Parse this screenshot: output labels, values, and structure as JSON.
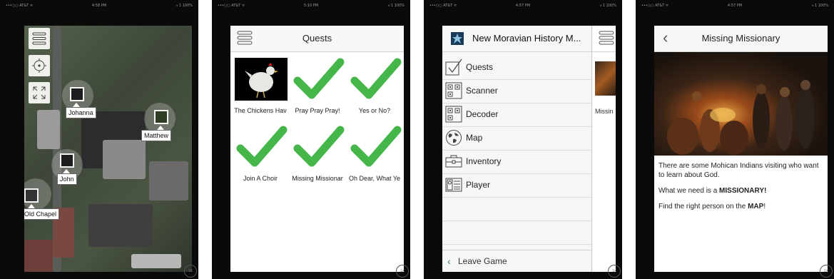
{
  "status_bar": {
    "carrier": "•••○○ AT&T ᯤ",
    "battery": "⁎ 1 100%"
  },
  "screens": [
    {
      "clock": "4:58 PM",
      "map": {
        "pins": [
          {
            "label": "Johanna"
          },
          {
            "label": "Matthew"
          },
          {
            "label": "John"
          },
          {
            "label": "Old Chapel"
          }
        ]
      },
      "zoom_badge": "1X"
    },
    {
      "clock": "5:10 PM",
      "title": "Quests",
      "quests": [
        {
          "label": "The Chickens Hav",
          "image": "chicken-image"
        },
        {
          "label": "Pray Pray Pray!",
          "image": "checkmark-icon"
        },
        {
          "label": "Yes or No?",
          "image": "checkmark-icon"
        },
        {
          "label": "Join A Choir",
          "image": "checkmark-icon"
        },
        {
          "label": "Missing Missionar",
          "image": "checkmark-icon"
        },
        {
          "label": "Oh Dear, What Ye",
          "image": "checkmark-icon"
        }
      ],
      "zoom_badge": "1X"
    },
    {
      "clock": "4:57 PM",
      "game_title": "New Moravian History M...",
      "menu": [
        {
          "label": "Quests",
          "icon": "checkbox-icon"
        },
        {
          "label": "Scanner",
          "icon": "qr-scanner-icon"
        },
        {
          "label": "Decoder",
          "icon": "qr-decoder-icon"
        },
        {
          "label": "Map",
          "icon": "globe-icon"
        },
        {
          "label": "Inventory",
          "icon": "briefcase-icon"
        },
        {
          "label": "Player",
          "icon": "id-card-icon"
        }
      ],
      "leave_label": "Leave Game",
      "peek_label": "Missin",
      "zoom_badge": "1X"
    },
    {
      "clock": "4:57 PM",
      "title": "Missing Missionary",
      "paragraphs": [
        "There are some Mohican Indians visiting who want to learn about God.",
        {
          "pre": "What we need is a ",
          "bold": "MISSIONARY!",
          "post": ""
        },
        {
          "pre": "Find the right person on the ",
          "bold": "MAP",
          "post": "!"
        }
      ],
      "zoom_badge": "1X"
    }
  ],
  "colors": {
    "check_green": "#45b649",
    "accent": "#3a7a70"
  }
}
